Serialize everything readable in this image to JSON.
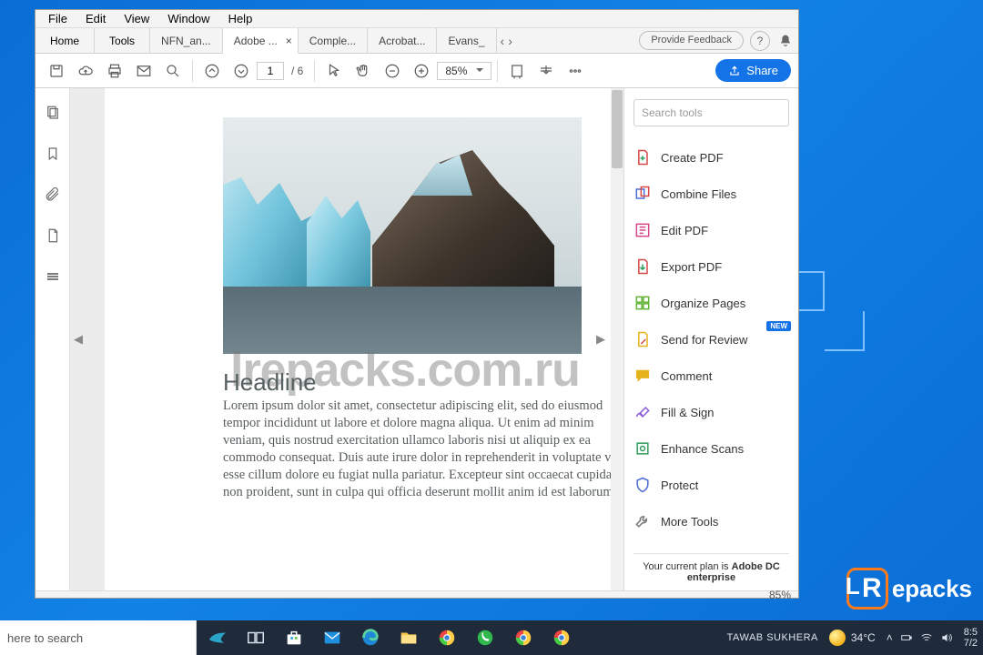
{
  "menu": {
    "file": "File",
    "edit": "Edit",
    "view": "View",
    "window": "Window",
    "help": "Help"
  },
  "tabs": {
    "home": "Home",
    "tools": "Tools",
    "docs": [
      "NFN_an...",
      "Adobe ...",
      "Comple...",
      "Acrobat...",
      "Evans_"
    ],
    "active_close": "×",
    "feedback": "Provide Feedback"
  },
  "toolbar": {
    "page_current": "1",
    "page_total": "/ 6",
    "zoom": "85%",
    "share": "Share"
  },
  "doc": {
    "headline": "Headline",
    "body": "Lorem ipsum dolor sit amet, consectetur adipiscing elit, sed do eiusmod tempor incididunt ut labore et dolore magna aliqua. Ut enim ad minim veniam, quis nostrud exercitation ullamco laboris nisi ut aliquip ex ea commodo consequat. Duis aute irure dolor in reprehenderit in voluptate velit esse cillum dolore eu fugiat nulla pariatur. Excepteur sint occaecat cupidatat non proident, sunt in culpa qui officia deserunt mollit anim id est laborum.",
    "watermark": "lrepacks.com.ru"
  },
  "rpanel": {
    "search_placeholder": "Search tools",
    "tools": [
      "Create PDF",
      "Combine Files",
      "Edit PDF",
      "Export PDF",
      "Organize Pages",
      "Send for Review",
      "Comment",
      "Fill & Sign",
      "Enhance Scans",
      "Protect",
      "More Tools"
    ],
    "badge": "NEW",
    "plan_a": "Your current plan is ",
    "plan_b": "Adobe DC enterprise"
  },
  "statusbar": {
    "zoom": "85%"
  },
  "logo": {
    "letter": "R",
    "text": "epacks"
  },
  "taskbar": {
    "search_value": "here to search",
    "user": "TAWAB SUKHERA",
    "temp": "34°C",
    "time": "8:5",
    "date": "7/2"
  }
}
